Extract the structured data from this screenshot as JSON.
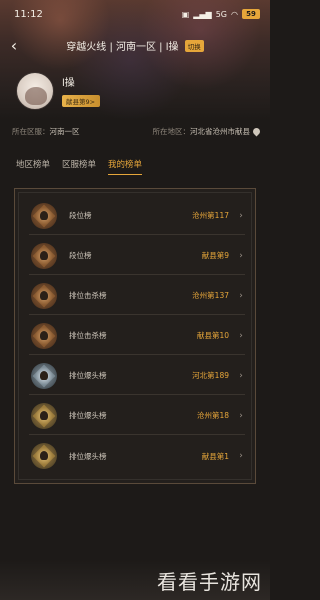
{
  "status_bar": {
    "time": "11:12",
    "network_text": "5G",
    "battery": "59"
  },
  "header": {
    "title": "穿越火线 | 河南一区 | l操",
    "switch_badge": "切换"
  },
  "profile": {
    "username": "l操",
    "rank_tag": "献县第9>"
  },
  "region": {
    "server_label": "所在区服：",
    "server_value": "河南一区",
    "location_label": "所在地区：",
    "location_value": "河北省沧州市献县"
  },
  "tabs": [
    {
      "label": "地区榜单",
      "active": false
    },
    {
      "label": "区服榜单",
      "active": false
    },
    {
      "label": "我的榜单",
      "active": true
    }
  ],
  "rankings": [
    {
      "label": "段位榜",
      "rank": "沧州第117",
      "emblem": "bronze-rank-emblem"
    },
    {
      "label": "段位榜",
      "rank": "献县第9",
      "emblem": "bronze-rank-emblem"
    },
    {
      "label": "排位击杀榜",
      "rank": "沧州第137",
      "emblem": "bronze-rank-emblem"
    },
    {
      "label": "排位击杀榜",
      "rank": "献县第10",
      "emblem": "bronze-rank-emblem"
    },
    {
      "label": "排位爆头榜",
      "rank": "河北第189",
      "emblem": "silver-rank-emblem"
    },
    {
      "label": "排位爆头榜",
      "rank": "沧州第18",
      "emblem": "gold-rank-emblem"
    },
    {
      "label": "排位爆头榜",
      "rank": "献县第1",
      "emblem": "gold-rank-emblem"
    }
  ],
  "watermark": "看看手游网",
  "colors": {
    "accent": "#e6a63a",
    "background": "#1d1a18",
    "panel_border": "#5a4a3a"
  }
}
